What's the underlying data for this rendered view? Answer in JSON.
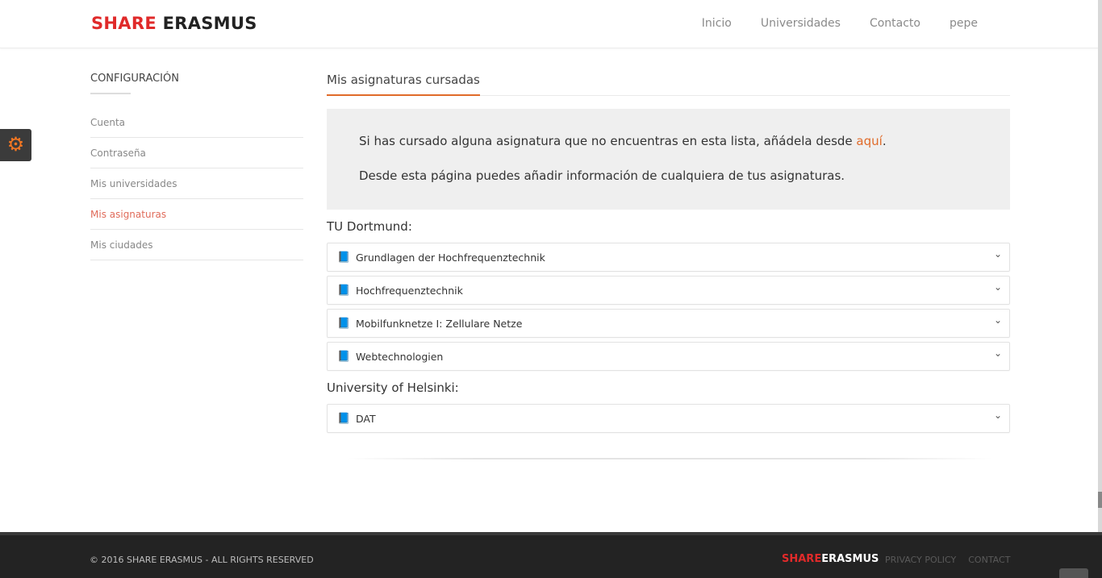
{
  "header": {
    "logo_part1": "SHARE",
    "logo_part2": "ERASMUS",
    "nav": [
      "Inicio",
      "Universidades",
      "Contacto",
      "pepe"
    ]
  },
  "settings_tab": {
    "icon": "gear-icon",
    "color": "#f47722"
  },
  "sidebar": {
    "title": "CONFIGURACIÓN",
    "items": [
      {
        "label": "Cuenta",
        "active": false
      },
      {
        "label": "Contraseña",
        "active": false
      },
      {
        "label": "Mis universidades",
        "active": false
      },
      {
        "label": "Mis asignaturas",
        "active": true
      },
      {
        "label": "Mis ciudades",
        "active": false
      }
    ]
  },
  "main": {
    "title": "Mis asignaturas cursadas",
    "info_line1_prefix": "Si has cursado alguna asignatura que no encuentras en esta lista, añádela desde ",
    "info_line1_link": "aquí",
    "info_line1_suffix": ".",
    "info_line2": "Desde esta página puedes añadir información de cualquiera de tus asignaturas.",
    "universities": [
      {
        "name": "TU Dortmund:",
        "courses": [
          "Grundlagen der Hochfrequenztechnik",
          "Hochfrequenztechnik",
          "Mobilfunknetze I: Zellulare Netze",
          "Webtechnologien"
        ]
      },
      {
        "name": "University of Helsinki:",
        "courses": [
          "DAT"
        ]
      }
    ]
  },
  "footer": {
    "copyright": "© 2016 SHARE ERASMUS - ALL RIGHTS RESERVED",
    "logo_part1": "SHARE",
    "logo_part2": "ERASMUS",
    "links": [
      "PRIVACY POLICY",
      "CONTACT"
    ]
  },
  "colors": {
    "accent": "#e06b2a",
    "brand_red": "#e02a2a",
    "active_sidebar": "#e06b5a"
  }
}
